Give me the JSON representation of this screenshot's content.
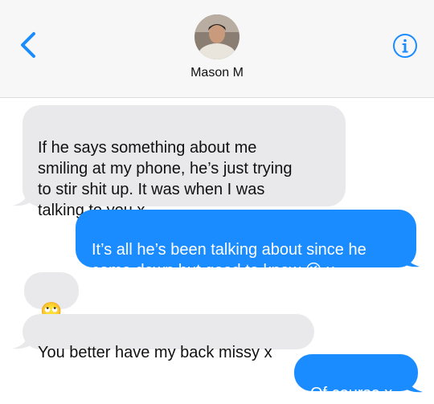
{
  "header": {
    "contact_name": "Mason M",
    "back_icon": "chevron-left-icon",
    "info_icon": "info-icon",
    "accent_color": "#1a8cff"
  },
  "messages": [
    {
      "direction": "incoming",
      "text": "If he says something about me\nsmiling at my phone, he’s just trying\nto stir shit up. It was when I was\ntalking to you x"
    },
    {
      "direction": "outgoing",
      "text_before": "It’s all he’s been talking about since he\ncame down but good to know ",
      "emoji": "😉",
      "text_after": " x"
    },
    {
      "direction": "incoming",
      "emoji": "🙄"
    },
    {
      "direction": "incoming",
      "text": "You better have my back missy x"
    },
    {
      "direction": "outgoing",
      "text": "Of course x"
    }
  ]
}
